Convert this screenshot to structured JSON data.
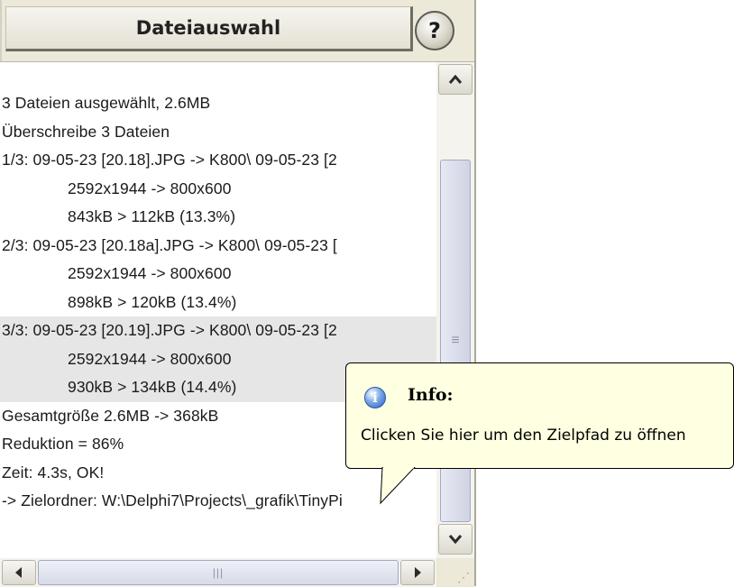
{
  "header": {
    "title": "Dateiauswahl",
    "help_label": "?"
  },
  "log": {
    "lines": [
      {
        "text": "3 Dateien ausgewählt, 2.6MB",
        "indent": false,
        "highlight": false
      },
      {
        "text": "Überschreibe 3 Dateien",
        "indent": false,
        "highlight": false
      },
      {
        "text": "1/3:  09-05-23 [20.18].JPG -> K800\\ 09-05-23 [2",
        "indent": false,
        "highlight": false
      },
      {
        "text": "2592x1944 -> 800x600",
        "indent": true,
        "highlight": false
      },
      {
        "text": "843kB > 112kB (13.3%)",
        "indent": true,
        "highlight": false
      },
      {
        "text": "2/3:  09-05-23 [20.18a].JPG -> K800\\ 09-05-23 [",
        "indent": false,
        "highlight": false
      },
      {
        "text": "2592x1944 -> 800x600",
        "indent": true,
        "highlight": false
      },
      {
        "text": "898kB > 120kB (13.4%)",
        "indent": true,
        "highlight": false
      },
      {
        "text": "3/3:  09-05-23 [20.19].JPG -> K800\\ 09-05-23 [2",
        "indent": false,
        "highlight": true
      },
      {
        "text": "2592x1944 -> 800x600",
        "indent": true,
        "highlight": true
      },
      {
        "text": "930kB > 134kB (14.4%)",
        "indent": true,
        "highlight": true
      },
      {
        "text": "Gesamtgröße 2.6MB -> 368kB",
        "indent": false,
        "highlight": false
      },
      {
        "text": "Reduktion = 86%",
        "indent": false,
        "highlight": false
      },
      {
        "text": "Zeit: 4.3s, OK!",
        "indent": false,
        "highlight": false
      },
      {
        "text": "-> Zielordner: W:\\Delphi7\\Projects\\_grafik\\TinyPi",
        "indent": false,
        "highlight": false
      }
    ]
  },
  "tooltip": {
    "title": "Info:",
    "text": "Clicken Sie hier um den Zielpfad zu öffnen",
    "icon": "info-icon"
  },
  "scrollbars": {
    "vertical_icons": [
      "scroll-up-arrow-icon",
      "scroll-down-arrow-icon"
    ],
    "horizontal_icons": [
      "scroll-left-arrow-icon",
      "scroll-right-arrow-icon"
    ]
  }
}
